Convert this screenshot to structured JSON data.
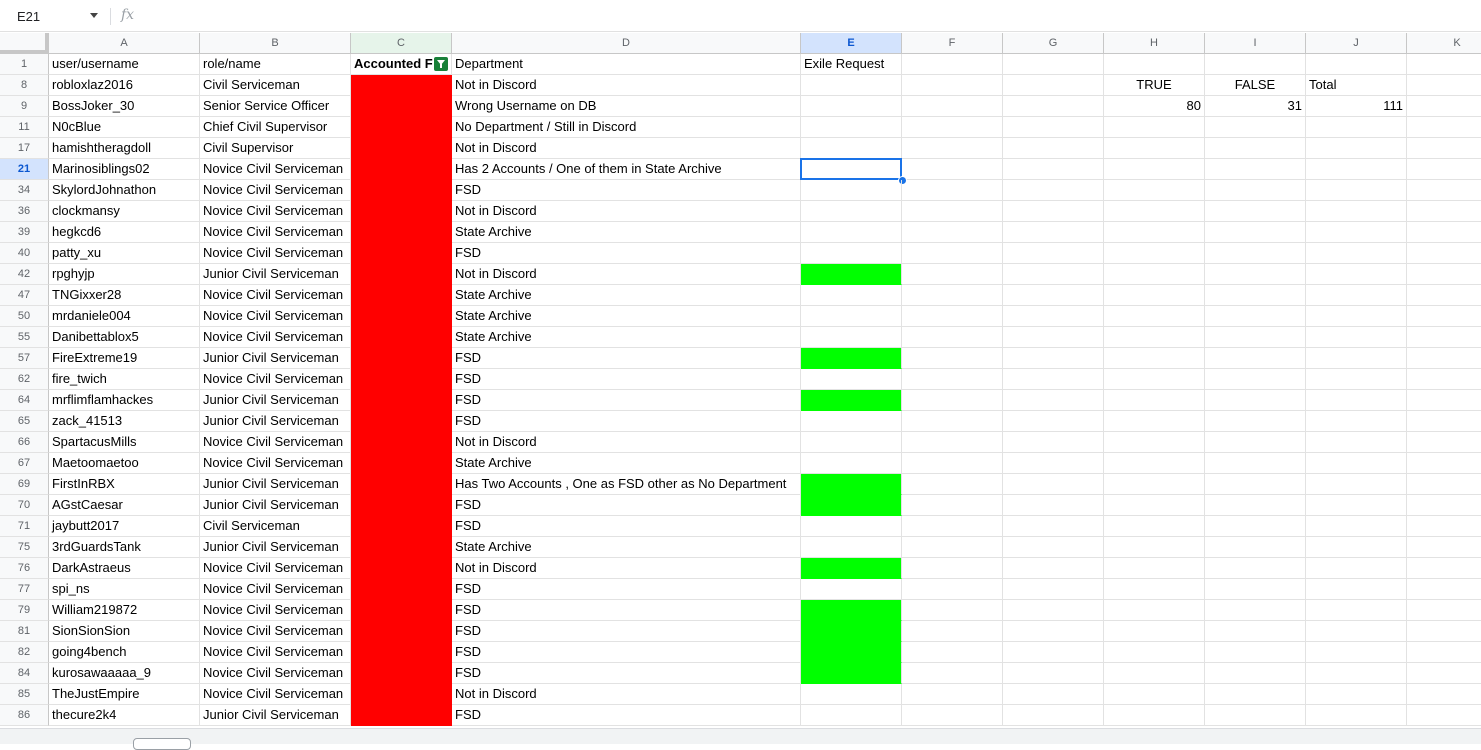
{
  "formula_bar": {
    "name_box": "E21",
    "fx_label": "fx",
    "formula": ""
  },
  "columns": [
    {
      "letter": "A"
    },
    {
      "letter": "B"
    },
    {
      "letter": "C"
    },
    {
      "letter": "D"
    },
    {
      "letter": "E"
    },
    {
      "letter": "F"
    },
    {
      "letter": "G"
    },
    {
      "letter": "H"
    },
    {
      "letter": "I"
    },
    {
      "letter": "J"
    },
    {
      "letter": "K"
    }
  ],
  "header_row": {
    "row_num": "1",
    "a": "user/username",
    "b": "role/name",
    "c": "Accounted F",
    "d": "Department",
    "e": "Exile Request"
  },
  "summary": {
    "h_label": "TRUE",
    "i_label": "FALSE",
    "j_label": "Total",
    "h_value": "80",
    "i_value": "31",
    "j_value": "111"
  },
  "rows": [
    {
      "n": "8",
      "a": "robloxlaz2016",
      "b": "Civil Serviceman",
      "d": "Not in Discord",
      "exile": false
    },
    {
      "n": "9",
      "a": "BossJoker_30",
      "b": "Senior Service Officer",
      "d": "Wrong Username on DB",
      "exile": false
    },
    {
      "n": "11",
      "a": "N0cBlue",
      "b": "Chief Civil Supervisor",
      "d": "No Department / Still in Discord",
      "exile": false
    },
    {
      "n": "17",
      "a": "hamishtheragdoll",
      "b": "Civil Supervisor",
      "d": "Not in Discord",
      "exile": false
    },
    {
      "n": "21",
      "a": "Marinosiblings02",
      "b": "Novice Civil Serviceman",
      "d": "Has 2 Accounts / One of them in State Archive",
      "exile": false
    },
    {
      "n": "34",
      "a": "SkylordJohnathon",
      "b": "Novice Civil Serviceman",
      "d": "FSD",
      "exile": false
    },
    {
      "n": "36",
      "a": "clockmansy",
      "b": "Novice Civil Serviceman",
      "d": "Not in Discord",
      "exile": false
    },
    {
      "n": "39",
      "a": "hegkcd6",
      "b": "Novice Civil Serviceman",
      "d": "State Archive",
      "exile": false
    },
    {
      "n": "40",
      "a": "patty_xu",
      "b": "Novice Civil Serviceman",
      "d": "FSD",
      "exile": false
    },
    {
      "n": "42",
      "a": "rpghyjp",
      "b": "Junior Civil Serviceman",
      "d": "Not in Discord",
      "exile": true
    },
    {
      "n": "47",
      "a": "TNGixxer28",
      "b": "Novice Civil Serviceman",
      "d": "State Archive",
      "exile": false
    },
    {
      "n": "50",
      "a": "mrdaniele004",
      "b": "Novice Civil Serviceman",
      "d": "State Archive",
      "exile": false
    },
    {
      "n": "55",
      "a": "Danibettablox5",
      "b": "Novice Civil Serviceman",
      "d": "State Archive",
      "exile": false
    },
    {
      "n": "57",
      "a": "FireExtreme19",
      "b": "Junior Civil Serviceman",
      "d": "FSD",
      "exile": true
    },
    {
      "n": "62",
      "a": "fire_twich",
      "b": "Novice Civil Serviceman",
      "d": "FSD",
      "exile": false
    },
    {
      "n": "64",
      "a": "mrflimflamhackes",
      "b": "Junior Civil Serviceman",
      "d": "FSD",
      "exile": true
    },
    {
      "n": "65",
      "a": "zack_41513",
      "b": "Junior Civil Serviceman",
      "d": "FSD",
      "exile": false
    },
    {
      "n": "66",
      "a": "SpartacusMills",
      "b": "Novice Civil Serviceman",
      "d": "Not in Discord",
      "exile": false
    },
    {
      "n": "67",
      "a": "Maetoomaetoo",
      "b": "Novice Civil Serviceman",
      "d": "State Archive",
      "exile": false
    },
    {
      "n": "69",
      "a": "FirstInRBX",
      "b": "Junior Civil Serviceman",
      "d": "Has Two Accounts , One as FSD other as No Department",
      "exile": true
    },
    {
      "n": "70",
      "a": "AGstCaesar",
      "b": "Junior Civil Serviceman",
      "d": "FSD",
      "exile": true
    },
    {
      "n": "71",
      "a": "jaybutt2017",
      "b": "Civil Serviceman",
      "d": "FSD",
      "exile": false
    },
    {
      "n": "75",
      "a": "3rdGuardsTank",
      "b": "Junior Civil Serviceman",
      "d": "State Archive",
      "exile": false
    },
    {
      "n": "76",
      "a": "DarkAstraeus",
      "b": "Novice Civil Serviceman",
      "d": "Not in Discord",
      "exile": true
    },
    {
      "n": "77",
      "a": "spi_ns",
      "b": "Novice Civil Serviceman",
      "d": "FSD",
      "exile": false
    },
    {
      "n": "79",
      "a": "William219872",
      "b": "Novice Civil Serviceman",
      "d": "FSD",
      "exile": true
    },
    {
      "n": "81",
      "a": "SionSionSion",
      "b": "Novice Civil Serviceman",
      "d": "FSD",
      "exile": true
    },
    {
      "n": "82",
      "a": "going4bench",
      "b": "Novice Civil Serviceman",
      "d": "FSD",
      "exile": true
    },
    {
      "n": "84",
      "a": "kurosawaaaaa_9",
      "b": "Novice Civil Serviceman",
      "d": "FSD",
      "exile": true
    },
    {
      "n": "85",
      "a": "TheJustEmpire",
      "b": "Novice Civil Serviceman",
      "d": "Not in Discord",
      "exile": false
    },
    {
      "n": "86",
      "a": "thecure2k4",
      "b": "Junior Civil Serviceman",
      "d": "FSD",
      "exile": false
    }
  ],
  "colors": {
    "accounted_false": "#ff0000",
    "exile_true": "#00ff00",
    "selection": "#1a73e8"
  }
}
